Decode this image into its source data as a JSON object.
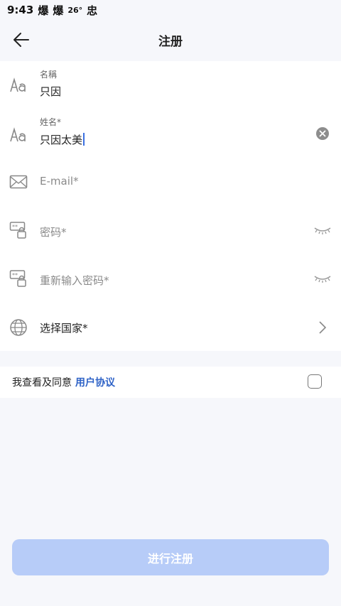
{
  "status_bar": {
    "time": "9:43",
    "notif_1": "爆",
    "notif_2": "爆",
    "temperature": "26°",
    "notif_3": "忠"
  },
  "header": {
    "title": "注册",
    "back_icon": "arrow-left-icon"
  },
  "form": {
    "nickname": {
      "label": "名稱",
      "value": "只因",
      "icon": "font-aa-icon"
    },
    "name": {
      "label": "姓名*",
      "value": "只因太美",
      "icon": "font-aa-icon",
      "clear_icon": "clear-circle-icon"
    },
    "email": {
      "placeholder": "E-mail*",
      "icon": "envelope-icon"
    },
    "password": {
      "placeholder": "密码*",
      "icon": "password-lock-icon",
      "toggle_icon": "eye-closed-icon"
    },
    "password_repeat": {
      "placeholder": "重新输入密码*",
      "icon": "password-lock-icon",
      "toggle_icon": "eye-closed-icon"
    },
    "country": {
      "label": "选择国家*",
      "icon": "globe-icon",
      "chevron": "chevron-right-icon"
    }
  },
  "agreement": {
    "text": "我查看及同意",
    "link": "用户协议",
    "checked": false
  },
  "submit": {
    "label": "进行注册",
    "enabled": false
  },
  "colors": {
    "background": "#f6f7fb",
    "accent": "#2f63c7",
    "button_disabled": "#b7ccf8"
  }
}
